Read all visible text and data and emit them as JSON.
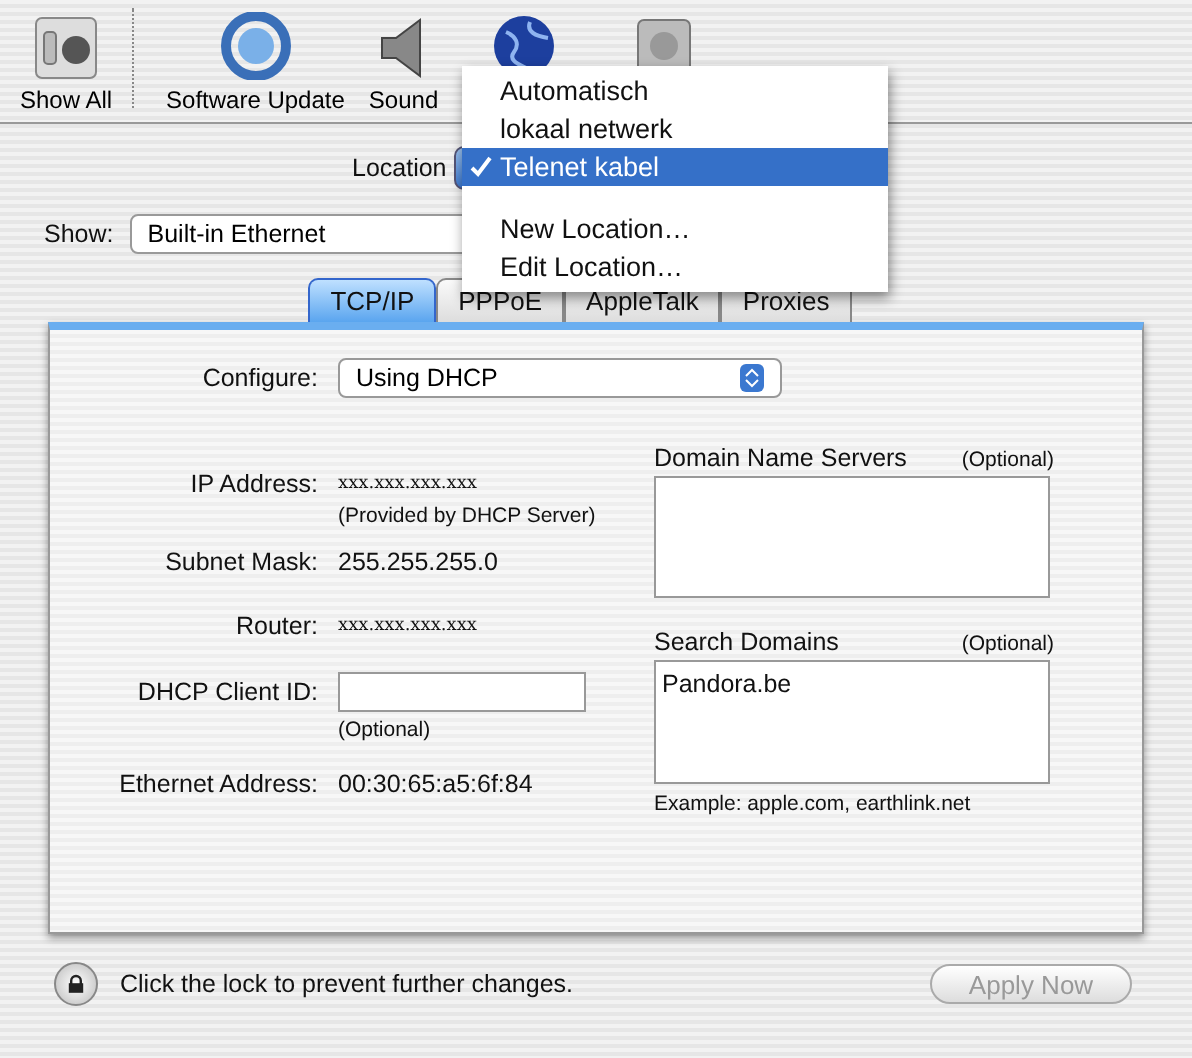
{
  "toolbar": {
    "items": [
      {
        "kind": "show-all",
        "label": "Show All"
      },
      {
        "kind": "update",
        "label": "Software Update"
      },
      {
        "kind": "sound",
        "label": "Sound"
      },
      {
        "kind": "network"
      },
      {
        "kind": "disk"
      }
    ]
  },
  "location": {
    "label": "Location"
  },
  "location_menu": {
    "locations": [
      {
        "label": "Automatisch",
        "selected": false
      },
      {
        "label": "lokaal netwerk",
        "selected": false
      },
      {
        "label": "Telenet kabel",
        "selected": true
      }
    ],
    "commands": [
      "New Location…",
      "Edit Location…"
    ]
  },
  "show": {
    "label": "Show:",
    "value": "Built-in Ethernet"
  },
  "tabs": [
    {
      "label": "TCP/IP",
      "selected": true
    },
    {
      "label": "PPPoE",
      "selected": false
    },
    {
      "label": "AppleTalk",
      "selected": false
    },
    {
      "label": "Proxies",
      "selected": false
    }
  ],
  "form": {
    "rows": [
      {
        "kind": "popup",
        "label": "Configure:",
        "value": "Using DHCP"
      },
      {
        "kind": "masked",
        "label": "IP Address:",
        "value": "xxx.xxx.xxx.xxx",
        "note": "(Provided by DHCP Server)"
      },
      {
        "kind": "text",
        "label": "Subnet Mask:",
        "value": "255.255.255.0"
      },
      {
        "kind": "masked",
        "label": "Router:",
        "value": "xxx.xxx.xxx.xxx"
      },
      {
        "kind": "input",
        "label": "DHCP Client ID:",
        "note": "(Optional)"
      },
      {
        "kind": "text",
        "label": "Ethernet Address:",
        "value": "00:30:65:a5:6f:84"
      }
    ]
  },
  "dns": {
    "label": "Domain Name Servers",
    "note": "(Optional)"
  },
  "search_domains": {
    "label": "Search Domains",
    "note": "(Optional)",
    "value": "Pandora.be",
    "example": "Example: apple.com, earthlink.net"
  },
  "footer": {
    "lock_text": "Click the lock to prevent further changes.",
    "apply": {
      "label": "Apply Now",
      "disabled": true
    }
  }
}
